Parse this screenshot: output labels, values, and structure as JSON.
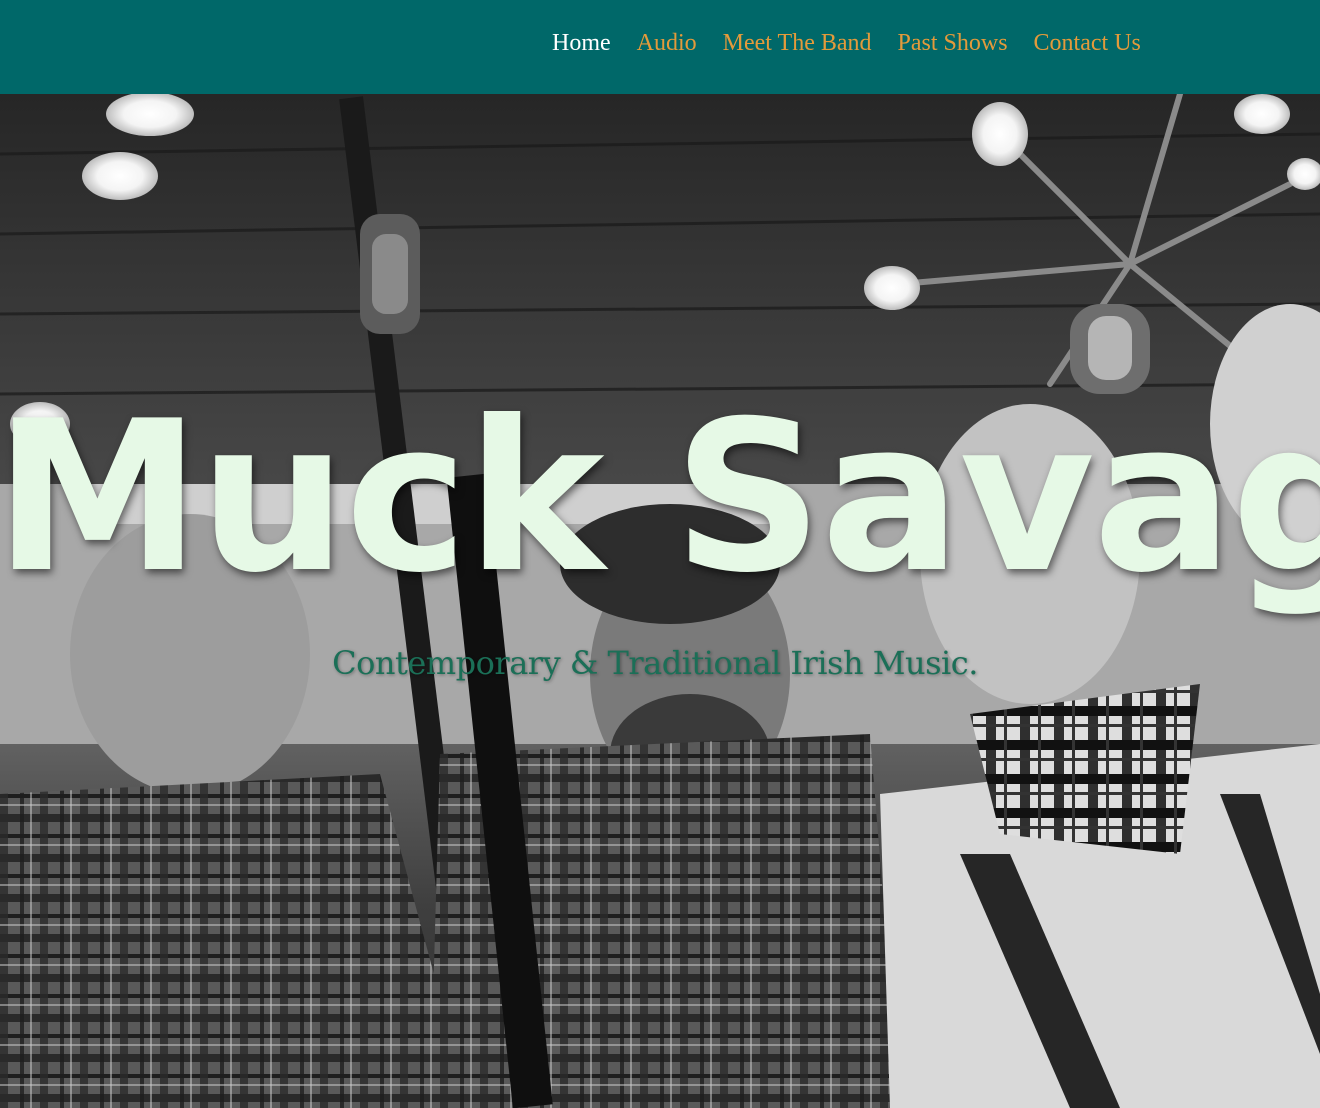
{
  "header": {
    "background": "#006869",
    "nav": [
      {
        "label": "Home",
        "active": true
      },
      {
        "label": "Audio",
        "active": false
      },
      {
        "label": "Meet The Band",
        "active": false
      },
      {
        "label": "Past Shows",
        "active": false
      },
      {
        "label": "Contact Us",
        "active": false
      }
    ],
    "active_color": "#ffffff",
    "link_color": "#e39a3b"
  },
  "hero": {
    "title": "Muck Savage",
    "subtitle": "Contemporary & Traditional Irish Music.",
    "title_color": "#e6f9e6",
    "subtitle_color": "#1b6f57",
    "image": "black-and-white photo of band members singing under hanging bulb lights with microphones"
  }
}
